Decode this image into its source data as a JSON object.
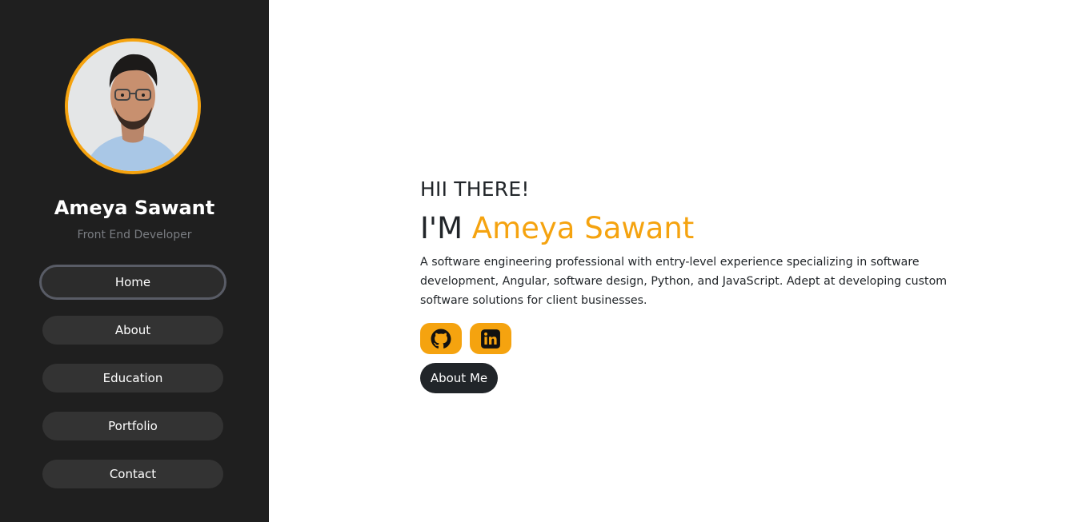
{
  "sidebar": {
    "profile_name": "Ameya Sawant",
    "profile_role": "Front End Developer",
    "nav": {
      "home": "Home",
      "about": "About",
      "education": "Education",
      "portfolio": "Portfolio",
      "contact": "Contact"
    },
    "active_item": "Home"
  },
  "hero": {
    "greeting": "HII THERE!",
    "intro_prefix": "I'M",
    "name": "Ameya Sawant",
    "bio": "A software engineering professional with entry-level experience specializing in software development, Angular, software design, Python, and JavaScript. Adept at developing custom software solutions for client businesses.",
    "social_icons": [
      "github-icon",
      "linkedin-icon"
    ],
    "cta_label": "About Me"
  },
  "colors": {
    "sidebar_bg": "#1f1f1f",
    "accent": "#f5a30f",
    "text_dark": "#212529",
    "nav_item_bg": "#333333",
    "muted": "#7a7d82"
  }
}
